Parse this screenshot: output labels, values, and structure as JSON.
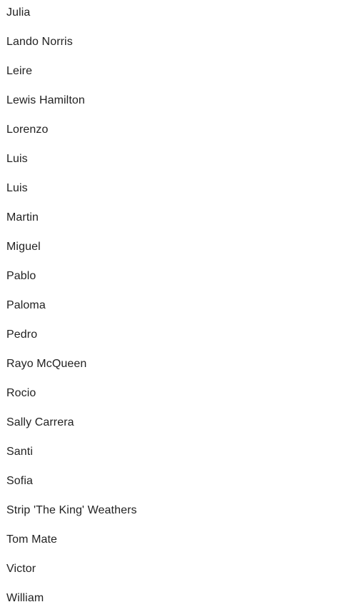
{
  "names": {
    "items": [
      "Julia",
      "Lando Norris",
      "Leire",
      "Lewis Hamilton",
      "Lorenzo",
      "Luis",
      "Luis",
      "Martin",
      "Miguel",
      "Pablo",
      "Paloma",
      "Pedro",
      "Rayo McQueen",
      "Rocio",
      "Sally Carrera",
      "Santi",
      "Sofia",
      "Strip 'The King' Weathers",
      "Tom Mate",
      "Victor",
      "William"
    ]
  },
  "colors": {
    "background": "#ffffff",
    "text": "#222222"
  }
}
